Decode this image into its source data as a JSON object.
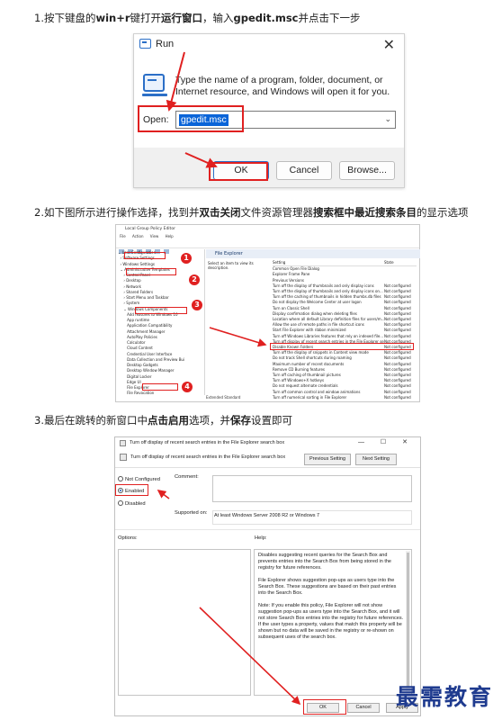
{
  "steps": {
    "step1": {
      "p1": "1.按下键盘的",
      "b1": "win+r",
      "p2": "键打开",
      "b2": "运行窗口",
      "p3": "，输入",
      "b3": "gpedit.msc",
      "p4": "并点击下一步"
    },
    "step2": {
      "p1": "2.如下图所示进行操作选择，找到并",
      "b1": "双击关闭",
      "p2": "文件资源管理器",
      "b2": "搜索框中最近搜索条目",
      "p3": "的显示选项"
    },
    "step3": {
      "p1": "3.最后在跳转的新窗口中",
      "b1": "点击启用",
      "p2": "选项，并",
      "b2": "保存",
      "p3": "设置即可"
    }
  },
  "run_dialog": {
    "title": "Run",
    "close_glyph": "✕",
    "description": "Type the name of a program, folder, document, or Internet resource, and Windows will open it for you.",
    "open_label": "Open:",
    "open_value": "gpedit.msc",
    "dropdown_glyph": "⌄",
    "ok": "OK",
    "cancel": "Cancel",
    "browse": "Browse..."
  },
  "gpe": {
    "title": "Local Group Policy Editor",
    "menu": [
      "File",
      "Action",
      "View",
      "Help"
    ],
    "tree": [
      "⌄ User Configuration",
      "  › Software Settings",
      "  › Windows Settings",
      "  ⌄ Administrative Templates",
      "     › Control Panel",
      "     › Desktop",
      "     › Network",
      "     › Shared Folders",
      "     › Start Menu and Taskbar",
      "     › System",
      "     ⌄ Windows Components",
      "        Add features to Windows 10",
      "        App runtime",
      "        Application Compatibility",
      "        Attachment Manager",
      "        AutoPlay Policies",
      "        Calculator",
      "        Cloud Content",
      "        Credential User Interface",
      "        Data Collection and Preview Bui",
      "        Desktop Gadgets",
      "        Desktop Window Manager",
      "        Digital Locker",
      "        Edge UI",
      "        File Explorer",
      "        File Revocation"
    ],
    "right_header": "File Explorer",
    "right_desc": "Select an item to view its description.",
    "col_setting": "Setting",
    "col_state": "State",
    "rows": [
      [
        "Common Open File Dialog",
        ""
      ],
      [
        "Explorer Frame Pane",
        ""
      ],
      [
        "Previous Versions",
        ""
      ],
      [
        "Turn off the display of thumbnails and only display icons",
        "Not configured"
      ],
      [
        "Turn off the display of thumbnails and only display icons on...",
        "Not configured"
      ],
      [
        "Turn off the caching of thumbnails in hidden thumbs.db files",
        "Not configured"
      ],
      [
        "Do not display the Welcome Center at user logon",
        "Not configured"
      ],
      [
        "Turn on Classic Shell",
        "Not configured"
      ],
      [
        "Display confirmation dialog when deleting files",
        "Not configured"
      ],
      [
        "Location where all default Library definition files for users/m...",
        "Not configured"
      ],
      [
        "Allow the use of remote paths in file shortcut icons",
        "Not configured"
      ],
      [
        "Start File Explorer with ribbon minimized",
        "Not configured"
      ],
      [
        "Turn off Windows Libraries features that rely on indexed file...",
        "Not configured"
      ],
      [
        "Turn off display of recent search entries in the File Explorer se...",
        "Not configured"
      ],
      [
        "Disable Known Folders",
        "Not configured"
      ],
      [
        "Turn off the display of snippets in Content view mode",
        "Not configured"
      ],
      [
        "Do not track Shell shortcuts during roaming",
        "Not configured"
      ],
      [
        "Maximum number of recent documents",
        "Not configured"
      ],
      [
        "Remove CD Burning features",
        "Not configured"
      ],
      [
        "Turn off caching of thumbnail pictures",
        "Not configured"
      ],
      [
        "Turn off Windows+X hotkeys",
        "Not configured"
      ],
      [
        "Do not request alternate credentials",
        "Not configured"
      ],
      [
        "Turn off common control and window animations",
        "Not configured"
      ],
      [
        "Turn off numerical sorting in File Explorer",
        "Not configured"
      ]
    ],
    "tabs": "Extended  Standard",
    "badges": [
      "1",
      "2",
      "3",
      "4"
    ]
  },
  "policy": {
    "title": "Turn off display of recent search entries in the File Explorer search box",
    "window_controls": "—  ☐  ✕",
    "header_text": "Turn off display of recent search entries in the File Explorer search box",
    "prev": "Previous Setting",
    "next": "Next Setting",
    "not_configured": "Not Configured",
    "enabled": "Enabled",
    "disabled": "Disabled",
    "comment_label": "Comment:",
    "supported_label": "Supported on:",
    "supported_value": "At least Windows Server 2008 R2 or Windows 7",
    "options_label": "Options:",
    "help_label": "Help:",
    "help": [
      "Disables suggesting recent queries for the Search Box and prevents entries into the Search Box from being stored in the registry for future references.",
      "File Explorer shows suggestion pop-ups as users type into the Search Box.  These suggestions are based on their past entries into the Search Box.",
      "Note: If you enable this policy, File Explorer will not show suggestion pop-ups as users type into the Search Box, and it will not store Search Box entries into the registry for future references.  If the user types a property, values that match this property will be shown but no data will be saved in the registry or re-shown on subsequent uses of the search box."
    ],
    "ok": "OK",
    "cancel": "Cancel",
    "apply": "Apply"
  },
  "watermark": "最需教育",
  "colors": {
    "annotation_red": "#e02020",
    "selection_blue": "#0a64d8",
    "watermark_blue": "#1f3b8f"
  }
}
